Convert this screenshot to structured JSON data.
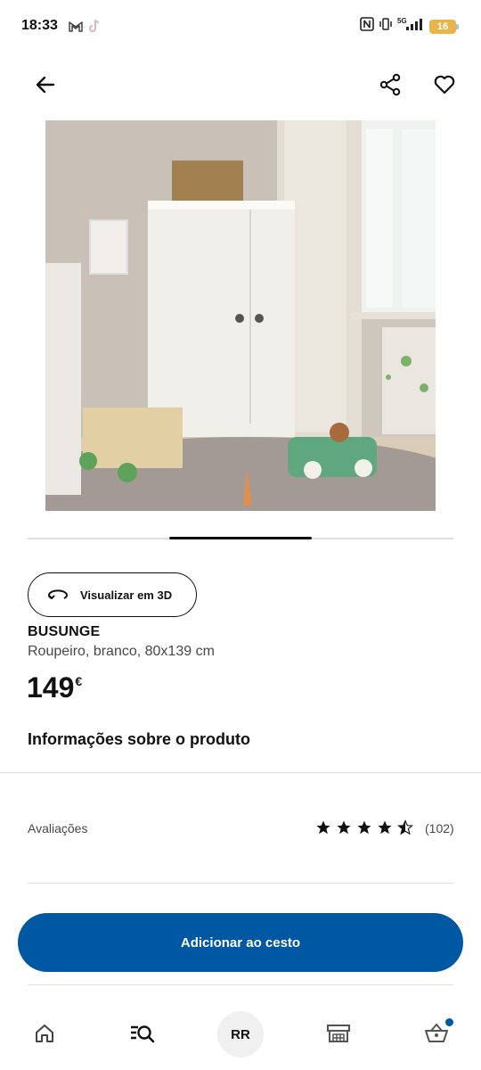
{
  "status_bar": {
    "time": "18:33",
    "battery": "16",
    "network": "5G",
    "icons": [
      "gmail-icon",
      "tiktok-icon",
      "nfc-icon",
      "vibrate-icon",
      "signal-icon",
      "battery-icon"
    ]
  },
  "header": {
    "icons": [
      "back-arrow-icon",
      "share-icon",
      "heart-icon"
    ]
  },
  "product": {
    "view_3d_label": "Visualizar em 3D",
    "name": "BUSUNGE",
    "description": "Roupeiro, branco, 80x139 cm",
    "price": "149",
    "currency": "€",
    "image_count": 3,
    "active_image": 2
  },
  "info": {
    "heading": "Informações sobre o produto"
  },
  "reviews": {
    "label": "Avaliações",
    "rating": 4.5,
    "max_rating": 5,
    "count": "(102)"
  },
  "actions": {
    "add_to_cart_label": "Adicionar ao cesto"
  },
  "bottom_nav": {
    "avatar_initials": "RR",
    "items": [
      "home-icon",
      "search-list-icon",
      "avatar",
      "store-icon",
      "basket-icon"
    ],
    "basket_has_items": true
  },
  "colors": {
    "brand_blue": "#0058a3",
    "text": "#111111",
    "muted_text": "#484848",
    "divider": "#dfdfdf"
  }
}
